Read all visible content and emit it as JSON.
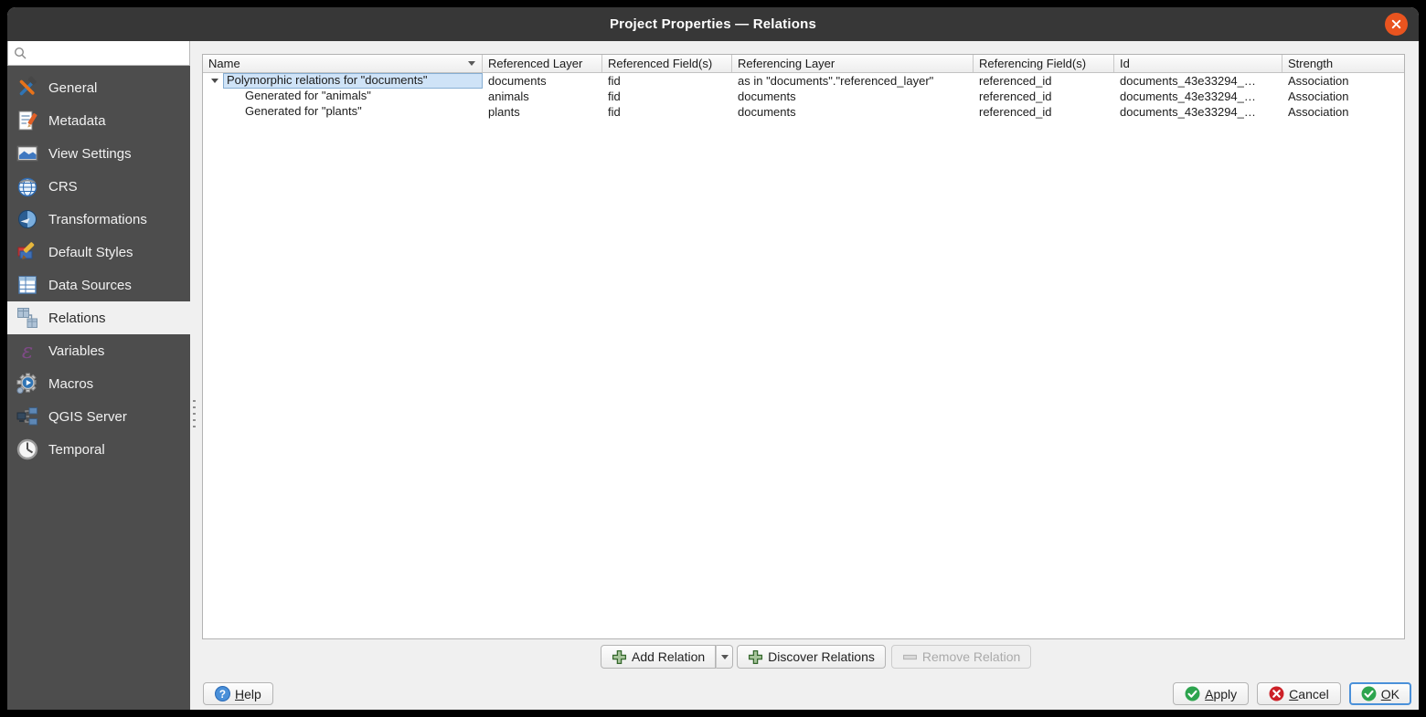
{
  "window": {
    "title": "Project Properties — Relations"
  },
  "sidebar": {
    "search": {
      "placeholder": "",
      "value": ""
    },
    "items": [
      {
        "label": "General"
      },
      {
        "label": "Metadata"
      },
      {
        "label": "View Settings"
      },
      {
        "label": "CRS"
      },
      {
        "label": "Transformations"
      },
      {
        "label": "Default Styles"
      },
      {
        "label": "Data Sources"
      },
      {
        "label": "Relations",
        "selected": true
      },
      {
        "label": "Variables"
      },
      {
        "label": "Macros"
      },
      {
        "label": "QGIS Server"
      },
      {
        "label": "Temporal"
      }
    ]
  },
  "relations_table": {
    "columns": [
      "Name",
      "Referenced Layer",
      "Referenced Field(s)",
      "Referencing Layer",
      "Referencing Field(s)",
      "Id",
      "Strength"
    ],
    "rows": [
      {
        "level": 0,
        "expanded": true,
        "selected": true,
        "cells": [
          "Polymorphic relations for \"documents\"",
          "documents",
          "fid",
          "as in \"documents\".\"referenced_layer\"",
          "referenced_id",
          "documents_43e33294_…",
          "Association"
        ]
      },
      {
        "level": 1,
        "cells": [
          "Generated for \"animals\"",
          "animals",
          "fid",
          "documents",
          "referenced_id",
          "documents_43e33294_…",
          "Association"
        ]
      },
      {
        "level": 1,
        "cells": [
          "Generated for \"plants\"",
          "plants",
          "fid",
          "documents",
          "referenced_id",
          "documents_43e33294_…",
          "Association"
        ]
      }
    ]
  },
  "actions": {
    "add_relation": "Add Relation",
    "discover_relations": "Discover Relations",
    "remove_relation": "Remove Relation"
  },
  "footer": {
    "help": "Help",
    "apply": "Apply",
    "cancel": "Cancel",
    "ok": "OK"
  },
  "colors": {
    "titlebar": "#373737",
    "sidebar": "#4d4d4d",
    "close_button_orange": "#e9541f",
    "selection_blue": "#cfe3f7",
    "button_icon_green": "#2da44e",
    "button_icon_red": "#cc2027"
  }
}
